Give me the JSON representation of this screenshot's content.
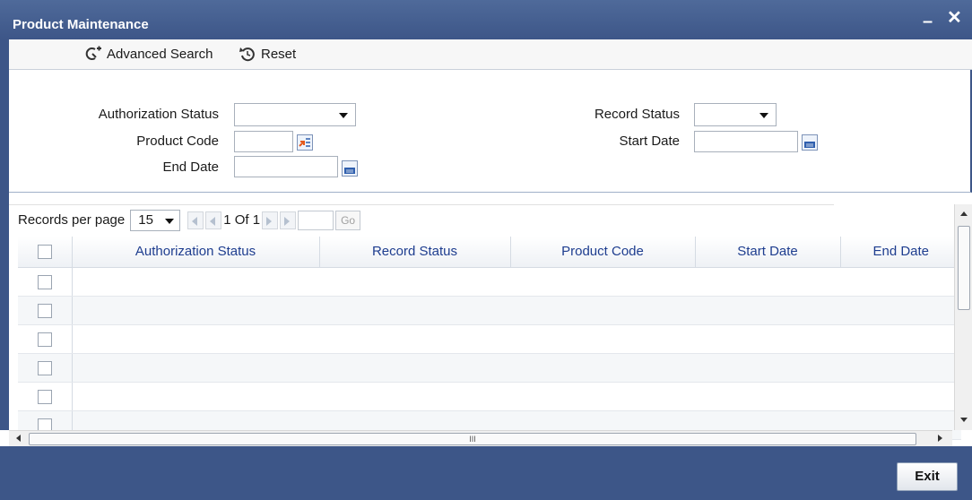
{
  "window": {
    "title": "Product Maintenance",
    "minimize_label": "–",
    "close_label": "✕"
  },
  "toolbar": {
    "advanced_search_label": "Advanced Search",
    "reset_label": "Reset"
  },
  "search": {
    "authorization_status_label": "Authorization Status",
    "record_status_label": "Record Status",
    "product_code_label": "Product Code",
    "start_date_label": "Start Date",
    "end_date_label": "End Date",
    "authorization_status_value": "",
    "record_status_value": "",
    "product_code_value": "",
    "start_date_value": "",
    "end_date_value": ""
  },
  "pager": {
    "records_per_page_label": "Records per page",
    "records_per_page_value": "15",
    "page_text": "1 Of 1",
    "go_label": "Go",
    "page_input_value": ""
  },
  "grid": {
    "columns": [
      "Authorization Status",
      "Record Status",
      "Product Code",
      "Start Date",
      "End Date"
    ],
    "rows": []
  },
  "scrollbar": {
    "grip_label": "III"
  },
  "footer": {
    "exit_label": "Exit"
  },
  "icons": [
    "advanced-search-icon",
    "reset-icon",
    "lov-icon",
    "calendar-icon",
    "first-page-icon",
    "prev-page-icon",
    "next-page-icon",
    "last-page-icon"
  ],
  "colors": {
    "header_bg": "#3d5688",
    "column_header_text": "#1e3d8f",
    "icon_blue": "#2f5fae",
    "icon_orange": "#e55a1c"
  }
}
